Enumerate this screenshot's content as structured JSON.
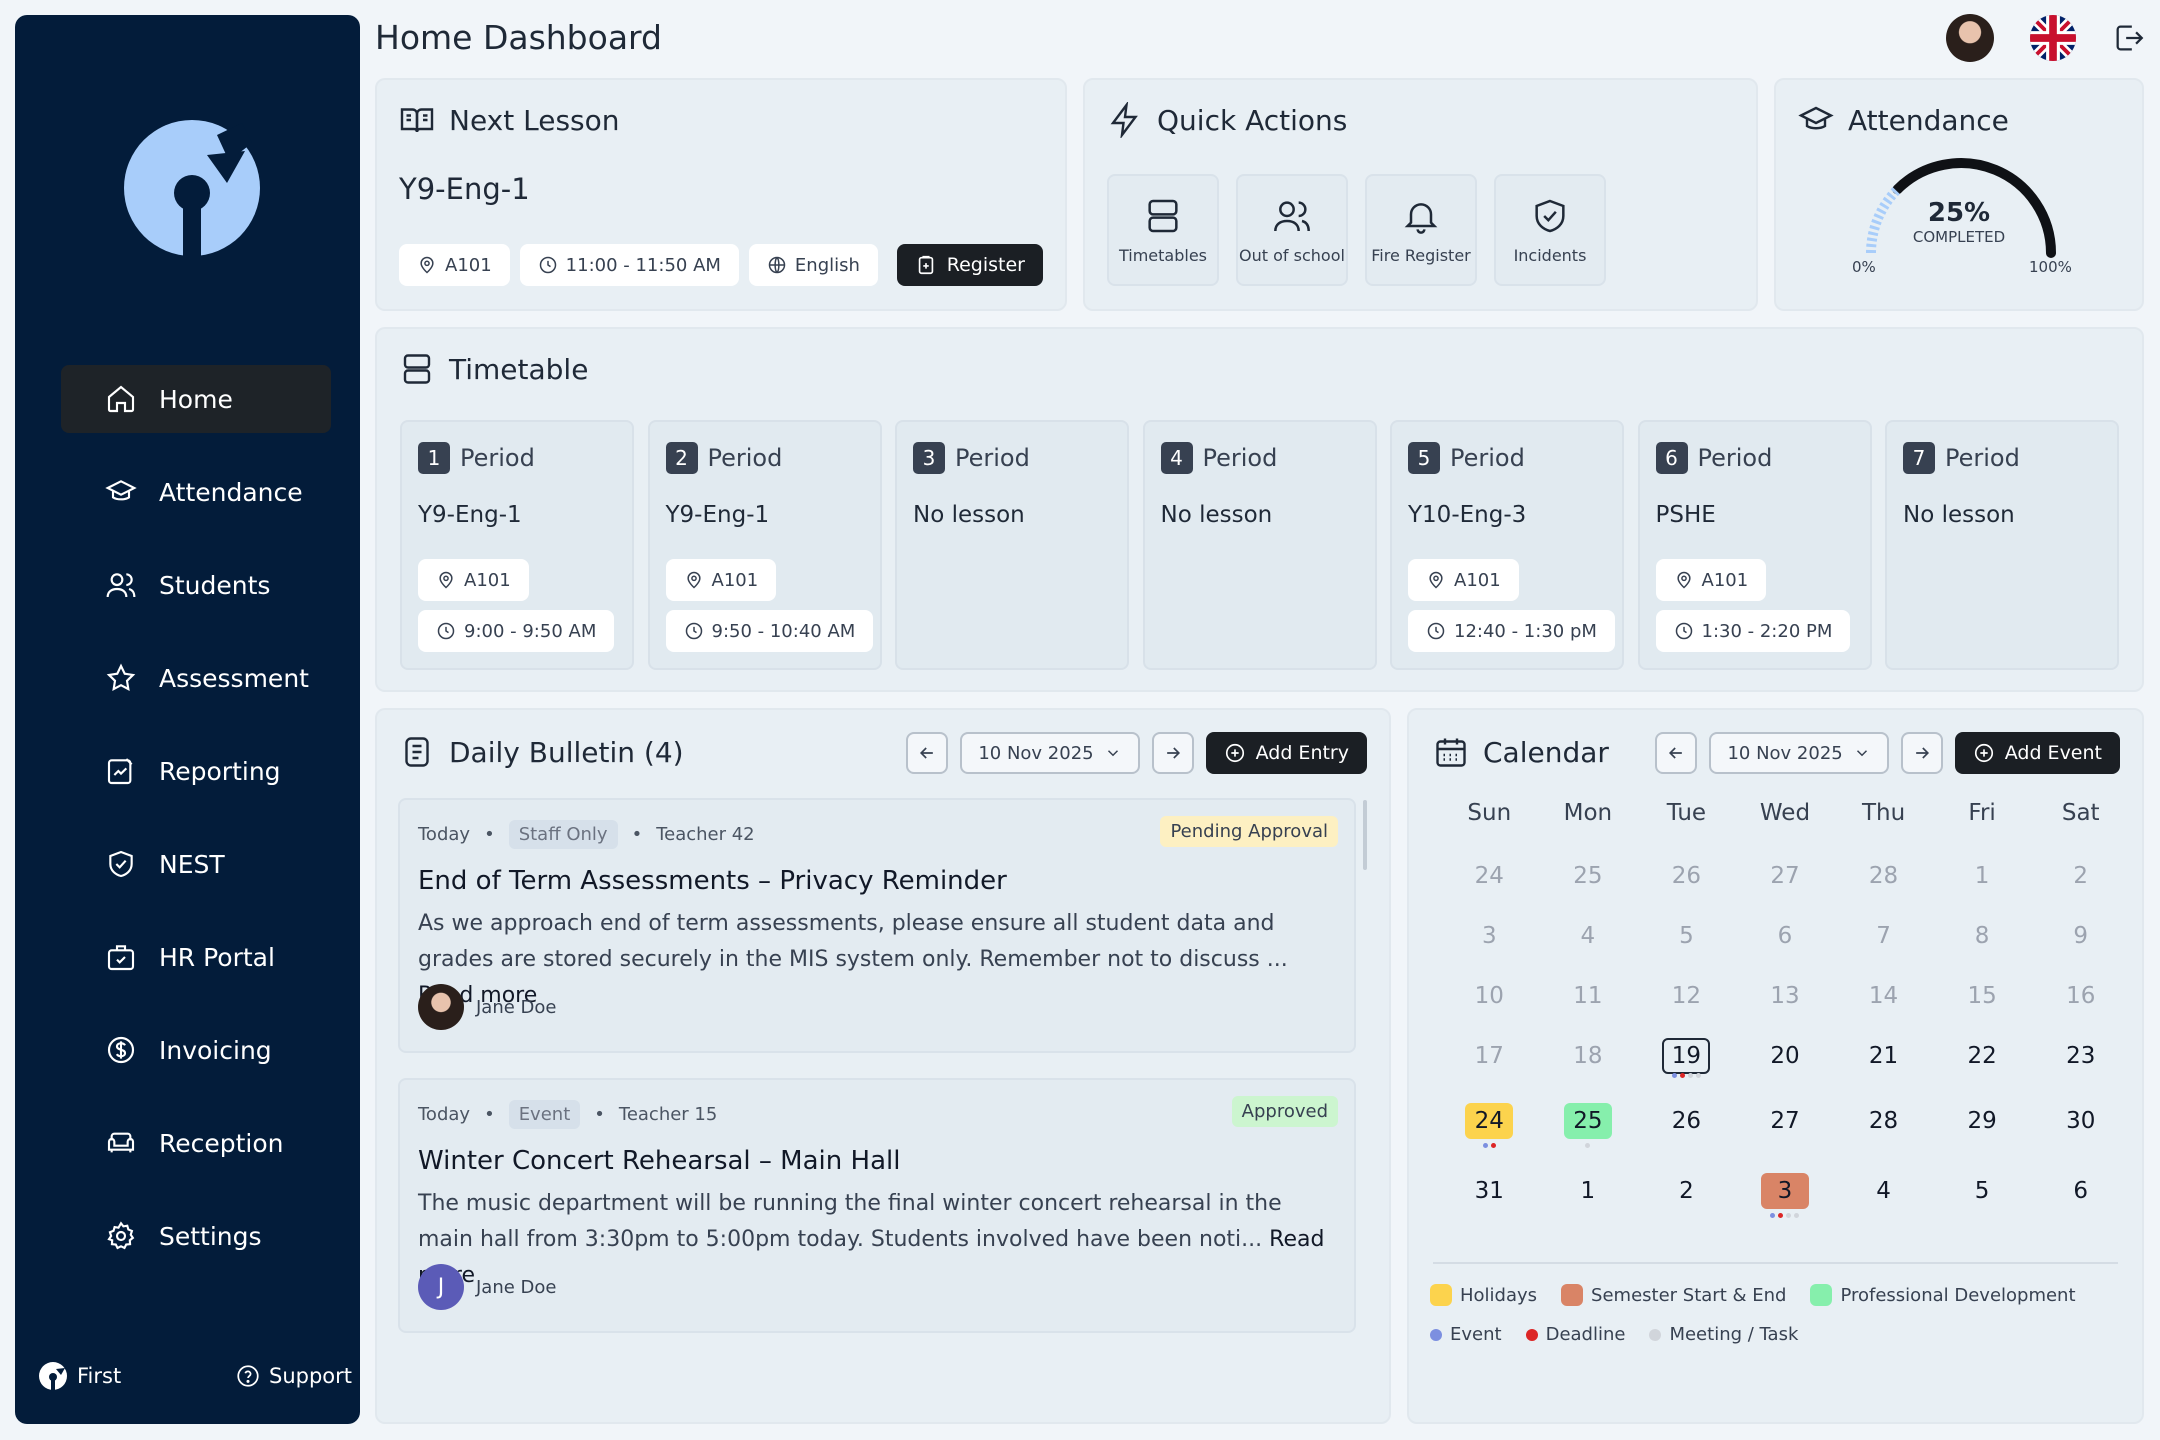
{
  "page": {
    "title": "Home Dashboard"
  },
  "sidebar": {
    "items": [
      {
        "label": "Home",
        "icon": "home-icon"
      },
      {
        "label": "Attendance",
        "icon": "graduation-cap-icon"
      },
      {
        "label": "Students",
        "icon": "users-icon"
      },
      {
        "label": "Assessment",
        "icon": "star-icon"
      },
      {
        "label": "Reporting",
        "icon": "report-icon"
      },
      {
        "label": "NEST",
        "icon": "shield-check-icon"
      },
      {
        "label": "HR Portal",
        "icon": "briefcase-check-icon"
      },
      {
        "label": "Invoicing",
        "icon": "dollar-circle-icon"
      },
      {
        "label": "Reception",
        "icon": "sofa-icon"
      },
      {
        "label": "Settings",
        "icon": "gear-icon"
      }
    ],
    "footer": {
      "brand": "First",
      "support": "Support"
    }
  },
  "next_lesson": {
    "title": "Next Lesson",
    "class": "Y9-Eng-1",
    "room": "A101",
    "time": "11:00 - 11:50 AM",
    "subject": "English",
    "register_label": "Register"
  },
  "quick_actions": {
    "title": "Quick Actions",
    "tiles": [
      "Timetables",
      "Out of school",
      "Fire Register",
      "Incidents"
    ]
  },
  "attendance": {
    "title": "Attendance",
    "percent_label": "25%",
    "completed_label": "COMPLETED",
    "progress": 0.25,
    "min_label": "0%",
    "max_label": "100%"
  },
  "timetable": {
    "title": "Timetable",
    "period_label": "Period",
    "periods": [
      {
        "num": "1",
        "class": "Y9-Eng-1",
        "room": "A101",
        "time": "9:00 - 9:50 AM"
      },
      {
        "num": "2",
        "class": "Y9-Eng-1",
        "room": "A101",
        "time": "9:50 - 10:40 AM"
      },
      {
        "num": "3",
        "class": "No lesson",
        "room": "",
        "time": ""
      },
      {
        "num": "4",
        "class": "No lesson",
        "room": "",
        "time": ""
      },
      {
        "num": "5",
        "class": "Y10-Eng-3",
        "room": "A101",
        "time": "12:40 - 1:30 pM"
      },
      {
        "num": "6",
        "class": "PSHE",
        "room": "A101",
        "time": "1:30 - 2:20 PM"
      },
      {
        "num": "7",
        "class": "No lesson",
        "room": "",
        "time": ""
      }
    ]
  },
  "bulletin": {
    "title": "Daily Bulletin (4)",
    "date": "10 Nov 2025",
    "add_label": "Add Entry",
    "posts": [
      {
        "day": "Today",
        "tag": "Staff Only",
        "author_meta": "Teacher 42",
        "status": "Pending Approval",
        "title": "End of Term Assessments – Privacy Reminder",
        "body": "As we approach end of term assessments, please ensure all student data and grades are stored securely in the MIS system only. Remember not to discuss ...",
        "read_more": "Read more",
        "author": "Jane Doe"
      },
      {
        "day": "Today",
        "tag": "Event",
        "author_meta": "Teacher 15",
        "status": "Approved",
        "title": "Winter Concert Rehearsal – Main Hall",
        "body": "The music department will be running the final winter concert rehearsal in the main hall from 3:30pm to 5:00pm today. Students involved have been noti...",
        "read_more": "Read more",
        "author": "Jane Doe",
        "author_initial": "J"
      }
    ]
  },
  "calendar": {
    "title": "Calendar",
    "date": "10 Nov 2025",
    "add_label": "Add Event",
    "weekdays": [
      "Sun",
      "Mon",
      "Tue",
      "Wed",
      "Thu",
      "Fri",
      "Sat"
    ],
    "weeks": [
      [
        "24",
        "25",
        "26",
        "27",
        "28",
        "1",
        "2"
      ],
      [
        "3",
        "4",
        "5",
        "6",
        "7",
        "8",
        "9"
      ],
      [
        "10",
        "11",
        "12",
        "13",
        "14",
        "15",
        "16"
      ],
      [
        "17",
        "18",
        "19",
        "20",
        "21",
        "22",
        "23"
      ],
      [
        "24",
        "25",
        "26",
        "27",
        "28",
        "29",
        "30"
      ],
      [
        "31",
        "1",
        "2",
        "3",
        "4",
        "5",
        "6"
      ]
    ],
    "legend": {
      "holidays": "Holidays",
      "semester": "Semester Start & End",
      "pd": "Professional Development",
      "event": "Event",
      "deadline": "Deadline",
      "meeting": "Meeting / Task"
    },
    "colors": {
      "holiday": "#fcd34d",
      "semester": "#d98466",
      "pd": "#86efac",
      "event": "#7c8fe0",
      "deadline": "#dc2626",
      "meeting": "#d1d5db"
    }
  }
}
